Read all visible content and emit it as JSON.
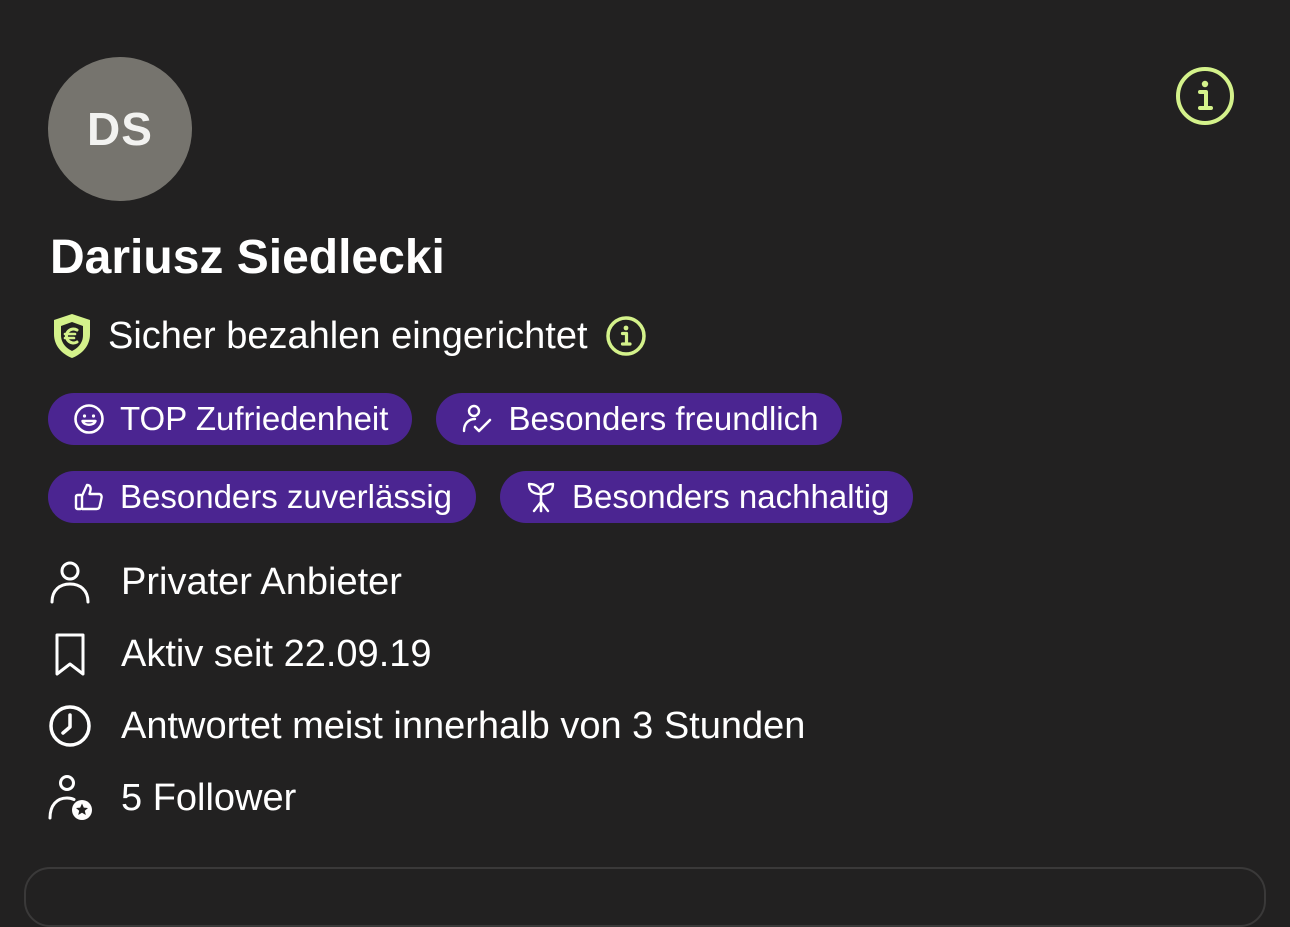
{
  "profile": {
    "initials": "DS",
    "name": "Dariusz Siedlecki"
  },
  "secure_payment": {
    "label": "Sicher bezahlen eingerichtet"
  },
  "badges": [
    {
      "label": "TOP Zufriedenheit",
      "icon": "smiley-icon"
    },
    {
      "label": "Besonders freundlich",
      "icon": "person-check-icon"
    },
    {
      "label": "Besonders zuverlässig",
      "icon": "thumbs-up-icon"
    },
    {
      "label": "Besonders nachhaltig",
      "icon": "sprout-icon"
    }
  ],
  "meta": [
    {
      "label": "Privater Anbieter",
      "icon": "person-icon"
    },
    {
      "label": "Aktiv seit 22.09.19",
      "icon": "bookmark-icon"
    },
    {
      "label": "Antwortet meist innerhalb von 3 Stunden",
      "icon": "clock-icon"
    },
    {
      "label": "5 Follower",
      "icon": "follower-icon"
    }
  ],
  "colors": {
    "background": "#222121",
    "accent": "#d4f28b",
    "badge": "#4b2591",
    "avatar": "#76746e"
  }
}
